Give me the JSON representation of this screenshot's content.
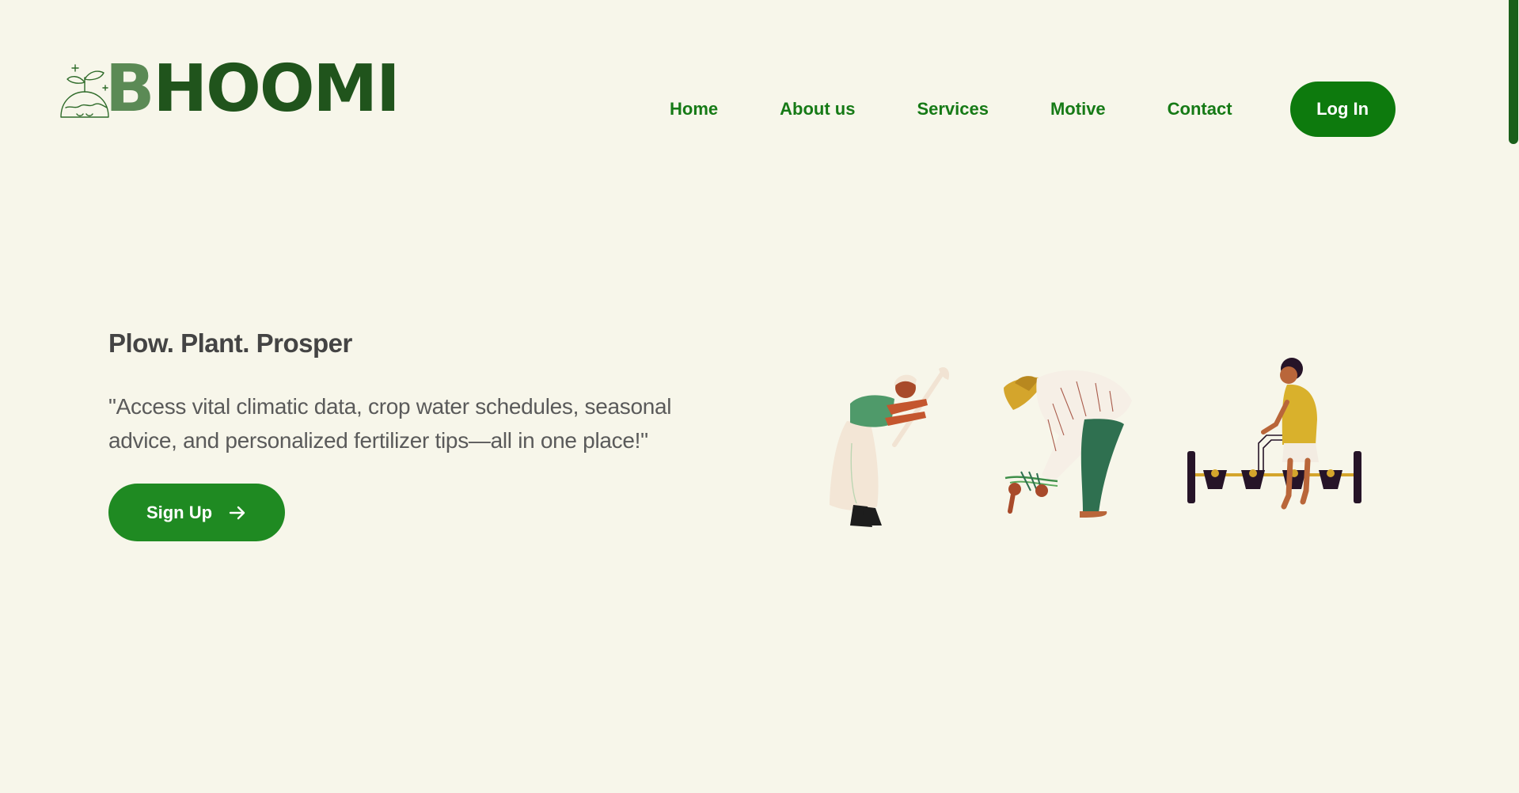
{
  "brand": {
    "name_first": "B",
    "name_rest": "HOOMI",
    "logo_icon": "sprout-globe-icon"
  },
  "nav": {
    "items": [
      {
        "label": "Home"
      },
      {
        "label": "About us"
      },
      {
        "label": "Services"
      },
      {
        "label": "Motive"
      },
      {
        "label": "Contact"
      }
    ],
    "login_label": "Log In"
  },
  "hero": {
    "title": "Plow. Plant. Prosper",
    "description": "\"Access vital climatic data, crop water schedules, seasonal advice, and personalized fertilizer tips—all in one place!\"",
    "signup_label": "Sign Up",
    "signup_icon": "arrow-right-icon",
    "illustration_icons": [
      "farmer-hoeing",
      "farmer-planting",
      "farmer-with-seed-drill"
    ]
  },
  "colors": {
    "background": "#f7f6ea",
    "brand_green": "#20541c",
    "nav_green": "#167a16",
    "button_green": "#0d7a0d",
    "signup_green": "#1f8a22",
    "text_dark": "#444444"
  }
}
